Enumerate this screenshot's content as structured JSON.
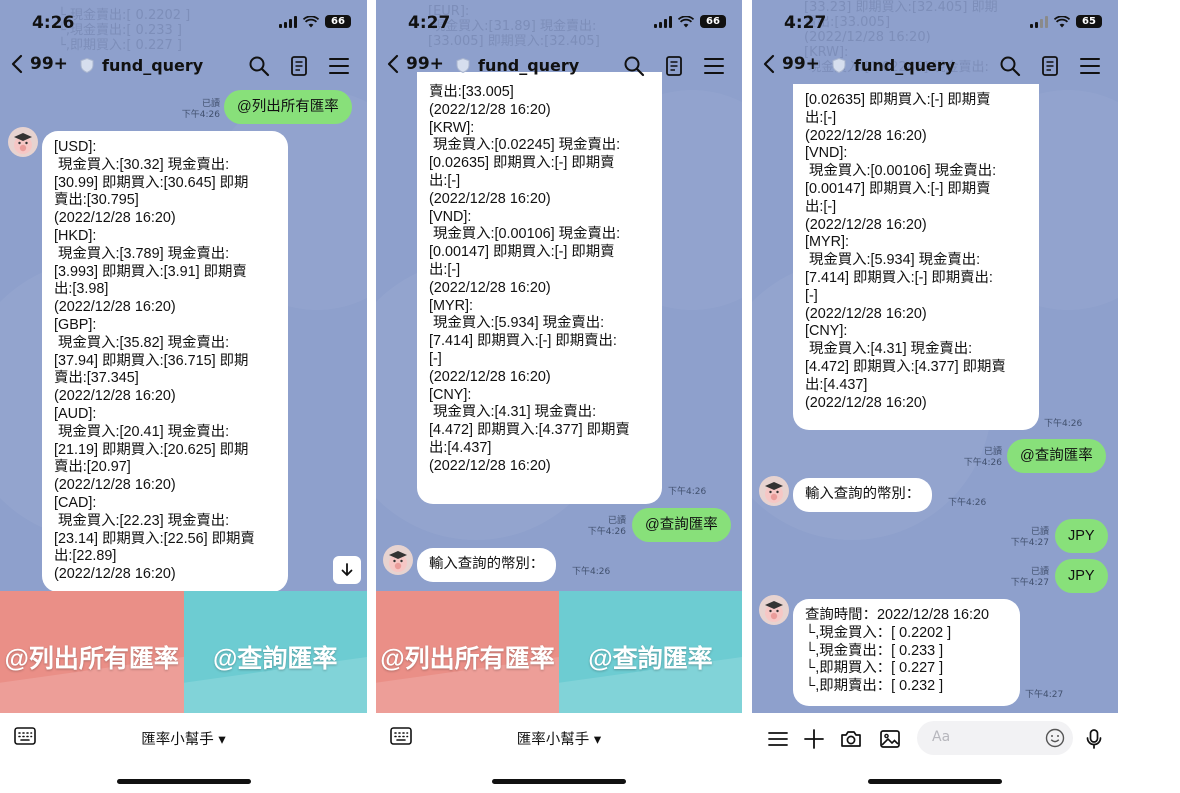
{
  "screens": [
    {
      "status": {
        "time": "4:26",
        "battery": "66"
      },
      "header": {
        "back_count": "99+",
        "room_name": "fund_query"
      },
      "faded_top": "└,現金賣出:[ 0.2202 ]\n└,現金賣出:[ 0.233 ]\n└,即期買入:[ 0.227 ]",
      "outgoing": [
        {
          "text": "@列出所有匯率",
          "read": "已讀",
          "time": "下午4:26"
        }
      ],
      "incoming": [
        {
          "text": "[USD]:\n 現金買入:[30.32] 現金賣出:\n[30.99] 即期買入:[30.645] 即期\n賣出:[30.795]\n(2022/12/28 16:20)\n[HKD]:\n 現金買入:[3.789] 現金賣出:\n[3.993] 即期買入:[3.91] 即期賣\n出:[3.98]\n(2022/12/28 16:20)\n[GBP]:\n 現金買入:[35.82] 現金賣出:\n[37.94] 即期買入:[36.715] 即期\n賣出:[37.345]\n(2022/12/28 16:20)\n[AUD]:\n 現金買入:[20.41] 現金賣出:\n[21.19] 即期買入:[20.625] 即期\n賣出:[20.97]\n(2022/12/28 16:20)\n[CAD]:\n 現金買入:[22.23] 現金賣出:\n[23.14] 即期買入:[22.56] 即期賣\n出:[22.89]\n(2022/12/28 16:20)"
        }
      ],
      "rich_menu": {
        "left": "@列出所有匯率",
        "right": "@查詢匯率"
      },
      "footer": {
        "title": "匯率小幫手 ▾"
      }
    },
    {
      "status": {
        "time": "4:27",
        "battery": "66"
      },
      "header": {
        "back_count": "99+",
        "room_name": "fund_query"
      },
      "faded_top": "[EUR]:\n 現金買入:[31.89] 現金賣出:\n[33.005] 即期買入:[32.405]",
      "incoming": [
        {
          "text": "賣出:[33.005]\n(2022/12/28 16:20)\n[KRW]:\n 現金買入:[0.02245] 現金賣出:\n[0.02635] 即期買入:[-] 即期賣\n出:[-]\n(2022/12/28 16:20)\n[VND]:\n 現金買入:[0.00106] 現金賣出:\n[0.00147] 即期買入:[-] 即期賣\n出:[-]\n(2022/12/28 16:20)\n[MYR]:\n 現金買入:[5.934] 現金賣出:\n[7.414] 即期買入:[-] 即期賣出:\n[-]\n(2022/12/28 16:20)\n[CNY]:\n 現金買入:[4.31] 現金賣出:\n[4.472] 即期買入:[4.377] 即期賣\n出:[4.437]\n(2022/12/28 16:20)",
          "time": "下午4:26"
        },
        {
          "text": "輸入查詢的幣別：",
          "time": "下午4:26"
        }
      ],
      "outgoing": [
        {
          "text": "@查詢匯率",
          "read": "已讀",
          "time": "下午4:26"
        }
      ],
      "rich_menu": {
        "left": "@列出所有匯率",
        "right": "@查詢匯率"
      },
      "footer": {
        "title": "匯率小幫手 ▾"
      }
    },
    {
      "status": {
        "time": "4:27",
        "battery": "65"
      },
      "header": {
        "back_count": "99+",
        "room_name": "fund_query"
      },
      "faded_top": "[33.23] 即期買入:[32.405] 即期\n賣出:[33.005]\n(2022/12/28 16:20)\n[KRW]:\n 現金買入:[0.02245] 現金賣出:",
      "incoming": [
        {
          "text": "[0.02635] 即期買入:[-] 即期賣\n出:[-]\n(2022/12/28 16:20)\n[VND]:\n 現金買入:[0.00106] 現金賣出:\n[0.00147] 即期買入:[-] 即期賣\n出:[-]\n(2022/12/28 16:20)\n[MYR]:\n 現金買入:[5.934] 現金賣出:\n[7.414] 即期買入:[-] 即期賣出:\n[-]\n(2022/12/28 16:20)\n[CNY]:\n 現金買入:[4.31] 現金賣出:\n[4.472] 即期買入:[4.377] 即期賣\n出:[4.437]\n(2022/12/28 16:20)",
          "time": "下午4:26"
        },
        {
          "text": "輸入查詢的幣別：",
          "time": "下午4:26"
        },
        {
          "text": "查詢時間：2022/12/28 16:20\n└,現金買入：[ 0.2202 ]\n└,現金賣出：[ 0.233 ]\n└,即期買入：[ 0.227 ]\n└,即期賣出：[ 0.232 ]",
          "time": "下午4:27"
        }
      ],
      "outgoing": [
        {
          "text": "@查詢匯率",
          "read": "已讀",
          "time": "下午4:26"
        },
        {
          "text": "JPY",
          "read": "已讀",
          "time": "下午4:27"
        },
        {
          "text": "JPY",
          "read": "已讀",
          "time": "下午4:27"
        }
      ],
      "input": {
        "placeholder": "Aa"
      }
    }
  ]
}
